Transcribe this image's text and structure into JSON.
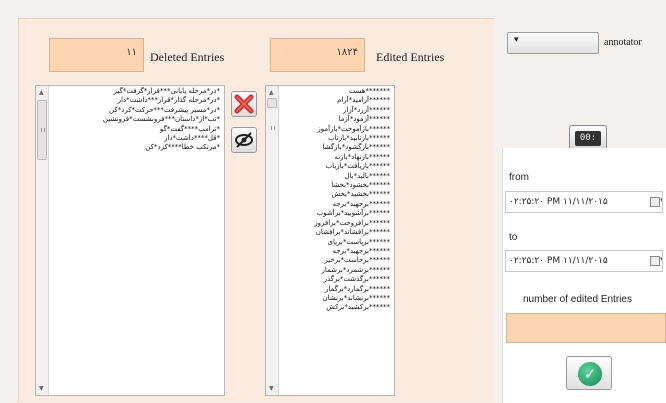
{
  "deleted": {
    "count": "۱۱",
    "label": "Deleted Entries",
    "rows": [
      "*در*مرحله پایانی***قرار*گرفت*گیر",
      "*در*مرحله گذار*قرار***داشت*دار",
      "*در*مسیر پیشرفت***حرکت*کرد*کن",
      "*تب*از*داستان***فرونشست*فرونشین",
      "*ترامپ****گفت*گو",
      "*قل****داشت*دار",
      "*مرتکب خطا****کرد*کن"
    ]
  },
  "edited": {
    "count": "۱۸۲۴",
    "label": "Edited Entries",
    "rows": [
      "*******هست",
      "******آرامید*آرام",
      "******آزرد*آزار",
      "******آزمود*آزما",
      "******بازآموخت*بازآموز",
      "******بازتابید*بازتاب",
      "******بازگشود*بازگشا",
      "******بازنهاد*بازنه",
      "******بازیافت*بازیاب",
      "******بالید*بال",
      "******بخشود*بخشا",
      "******بخشید*بخش",
      "******برجهید*برجه",
      "******برآشوبید*برآشوب",
      "******برافروخت*برافروز",
      "******برافشاند*برافشان",
      "******برپاست*برپای",
      "******برجهید*برجه",
      "******برخاست*برخیز",
      "******برشمرد*برشمار",
      "******برگذشت*برگذر",
      "******برگمارد*برگمار",
      "******برنشاند*برنشان",
      "******برکشید*برکش"
    ]
  },
  "actions": {
    "delete_icon": "close-x-icon",
    "hide_icon": "eye-slash-icon"
  },
  "sidebar": {
    "dropdown_value": "",
    "dropdown_label": "annotator",
    "clock_display": "00:",
    "from_label": "from",
    "from_value": "۰۲:۲۵:۲۰ PM ۱۱/۱۱/۲۰۱۵",
    "to_label": "to",
    "to_value": "۰۲:۲۵:۲۰ PM ۱۱/۱۱/۲۰۱۵",
    "edited_count_label": "number of edited Entries",
    "edited_count_value": ""
  },
  "colors": {
    "panel": "#fbebdf",
    "count_box": "#fdd5b1",
    "delete_red": "#d92b2b",
    "ok_green": "#1aa565"
  }
}
